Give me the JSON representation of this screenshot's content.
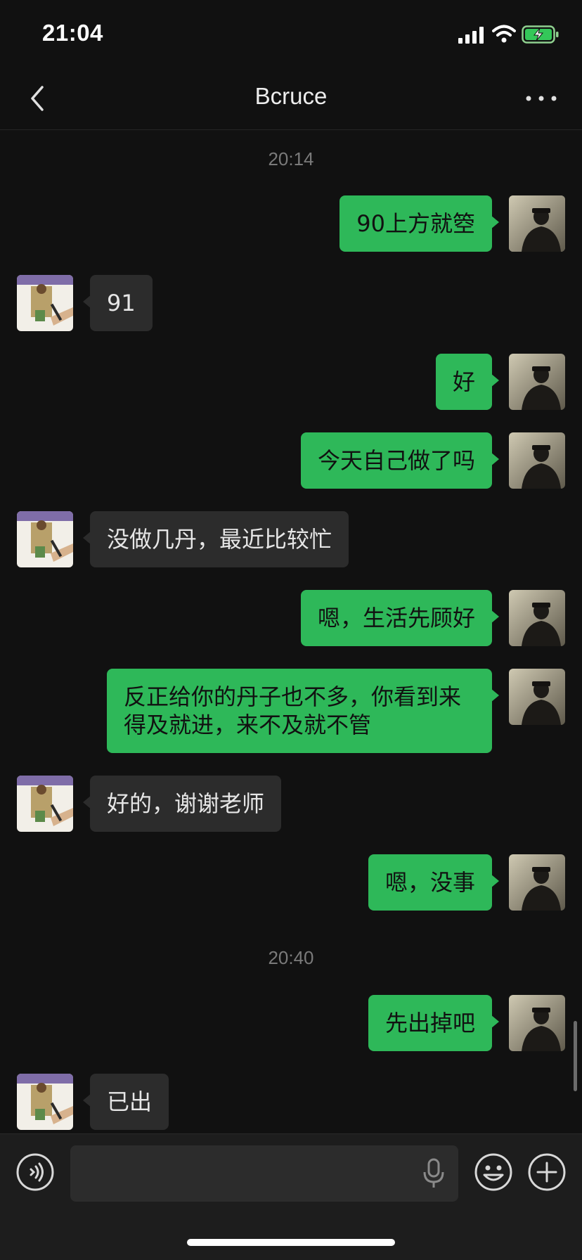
{
  "status_bar": {
    "time": "21:04"
  },
  "header": {
    "title": "Bcruce"
  },
  "messages": [
    {
      "kind": "time",
      "text": "20:14"
    },
    {
      "kind": "out",
      "text": "90上方就箜"
    },
    {
      "kind": "in",
      "text": "91"
    },
    {
      "kind": "out",
      "text": "好"
    },
    {
      "kind": "out",
      "text": "今天自己做了吗"
    },
    {
      "kind": "in",
      "text": "没做几丹，最近比较忙"
    },
    {
      "kind": "out",
      "text": "嗯，生活先顾好"
    },
    {
      "kind": "out",
      "text": "反正给你的丹子也不多，你看到来得及就进，来不及就不管"
    },
    {
      "kind": "in",
      "text": "好的，谢谢老师"
    },
    {
      "kind": "out",
      "text": "嗯，没事"
    },
    {
      "kind": "time",
      "text": "20:40"
    },
    {
      "kind": "out",
      "text": "先出掉吧"
    },
    {
      "kind": "in",
      "text": "已出"
    }
  ],
  "input_bar": {
    "text_value": ""
  },
  "colors": {
    "outgoing_bubble": "#2eb859",
    "incoming_bubble": "#2c2c2c",
    "background": "#111111"
  },
  "icons": [
    "back-arrow-icon",
    "more-icon",
    "voice-icon",
    "microphone-icon",
    "emoji-icon",
    "plus-icon"
  ]
}
